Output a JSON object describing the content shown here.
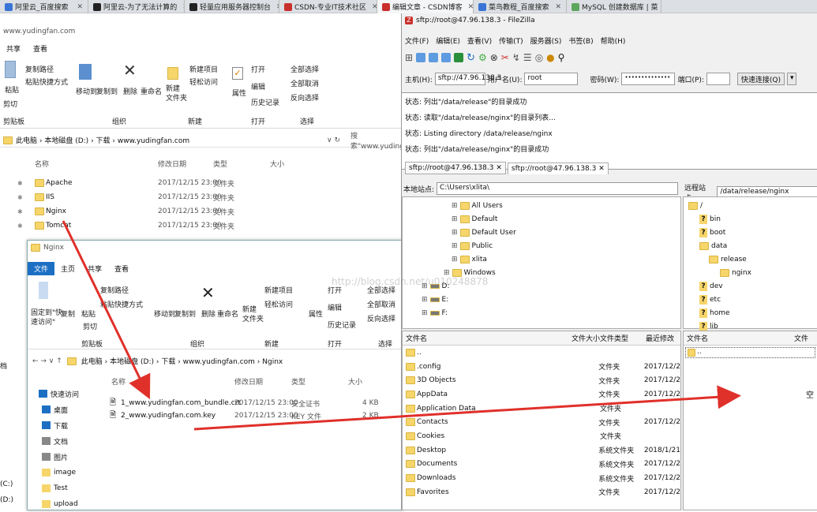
{
  "browser_tabs": [
    {
      "label": "阿里云_百度搜索",
      "color": "#3a74d6"
    },
    {
      "label": "阿里云-为了无法计算的",
      "color": "#222"
    },
    {
      "label": "轻量应用服务器控制台",
      "color": "#222"
    },
    {
      "label": "CSDN-专业IT技术社区",
      "color": "#c9302c"
    },
    {
      "label": "编辑文章 - CSDN博客",
      "color": "#c9302c",
      "active": true
    },
    {
      "label": "菜鸟教程_百度搜索",
      "color": "#3a74d6"
    },
    {
      "label": "MySQL 创建数据库 | 菜",
      "color": "#5ca65c"
    }
  ],
  "explorer": {
    "address_url": "www.yudingfan.com",
    "ribbon_tabs": [
      "共享",
      "查看"
    ],
    "ribbon": {
      "paste": "粘贴",
      "copy_path": "复制路径",
      "paste_shortcut": "粘贴快捷方式",
      "cut": "剪切",
      "move_to": "移动到",
      "copy_to": "复制到",
      "delete": "删除",
      "rename": "重命名",
      "new_item": "新建项目",
      "easy_access": "轻松访问",
      "new_folder": "新建\n文件夹",
      "properties": "属性",
      "open": "打开",
      "edit": "编辑",
      "history": "历史记录",
      "select_all": "全部选择",
      "select_none": "全部取消",
      "invert": "反向选择",
      "groups": [
        "剪贴板",
        "组织",
        "新建",
        "打开",
        "选择"
      ]
    },
    "path": [
      "此电脑",
      "本地磁盘 (D:)",
      "下载",
      "www.yudingfan.com"
    ],
    "search_placeholder": "搜索\"www.yuding",
    "columns": [
      "名称",
      "修改日期",
      "类型",
      "大小"
    ],
    "rows": [
      {
        "name": "Apache",
        "date": "2017/12/15 23:00",
        "type": "文件夹"
      },
      {
        "name": "IIS",
        "date": "2017/12/15 23:00",
        "type": "文件夹"
      },
      {
        "name": "Nginx",
        "date": "2017/12/15 23:00",
        "type": "文件夹"
      },
      {
        "name": "Tomcat",
        "date": "2017/12/15 23:00",
        "type": "文件夹"
      }
    ],
    "left_side_labels": [
      "档",
      "(C:)",
      "(D:)"
    ]
  },
  "explorer2": {
    "title": "Nginx",
    "ribbon_tabs": [
      "文件",
      "主页",
      "共享",
      "查看"
    ],
    "pin": "固定到\"快\n速访问\"",
    "copy": "复制",
    "paste": "粘贴",
    "cut": "剪切",
    "path": [
      "此电脑",
      "本地磁盘 (D:)",
      "下载",
      "www.yudingfan.com",
      "Nginx"
    ],
    "columns": [
      "名称",
      "修改日期",
      "类型",
      "大小"
    ],
    "files": [
      {
        "name": "1_www.yudingfan.com_bundle.crt",
        "date": "2017/12/15 23:00",
        "type": "安全证书",
        "size": "4 KB"
      },
      {
        "name": "2_www.yudingfan.com.key",
        "date": "2017/12/15 23:00",
        "type": "KEY 文件",
        "size": "2 KB"
      }
    ],
    "nav": [
      "快速访问",
      "桌面",
      "下载",
      "文档",
      "图片",
      "image",
      "Test",
      "upload"
    ]
  },
  "filezilla": {
    "title": "sftp://root@47.96.138.3 - FileZilla",
    "menu": [
      "文件(F)",
      "编辑(E)",
      "查看(V)",
      "传输(T)",
      "服务器(S)",
      "书签(B)",
      "帮助(H)"
    ],
    "host_label": "主机(H):",
    "host": "sftp://47.96.138.3",
    "user_label": "用户名(U):",
    "user": "root",
    "pass_label": "密码(W):",
    "pass": "••••••••••••••",
    "port_label": "端口(P):",
    "port": "",
    "connect": "快速连接(Q)",
    "log": [
      "状态:  列出\"/data/release\"的目录成功",
      "状态:  读取\"/data/release/nginx\"的目录列表...",
      "状态:  Listing directory /data/release/nginx",
      "状态:  列出\"/data/release/nginx\"的目录成功"
    ],
    "tabs": [
      "sftp://root@47.96.138.3",
      "sftp://root@47.96.138.3"
    ],
    "local_label": "本地站点:",
    "local_path": "C:\\Users\\xlita\\",
    "remote_label": "远程站点:",
    "remote_path": "/data/release/nginx",
    "local_tree": [
      "All Users",
      "Default",
      "Default User",
      "Public",
      "xlita",
      "Windows",
      "D:",
      "E:",
      "F:"
    ],
    "remote_tree": [
      "/",
      "bin",
      "boot",
      "data",
      "release",
      "nginx",
      "dev",
      "etc",
      "home",
      "lib"
    ],
    "local_cols": [
      "文件名",
      "文件大小",
      "文件类型",
      "最近修改"
    ],
    "remote_cols": [
      "文件名",
      "文件"
    ],
    "local_files": [
      {
        "name": "..",
        "type": "",
        "date": ""
      },
      {
        "name": ".config",
        "type": "文件夹",
        "date": "2017/12/2"
      },
      {
        "name": "3D Objects",
        "type": "文件夹",
        "date": "2017/12/2"
      },
      {
        "name": "AppData",
        "type": "文件夹",
        "date": "2017/12/2"
      },
      {
        "name": "Application Data",
        "type": "文件夹",
        "date": ""
      },
      {
        "name": "Contacts",
        "type": "文件夹",
        "date": "2017/12/2"
      },
      {
        "name": "Cookies",
        "type": "文件夹",
        "date": ""
      },
      {
        "name": "Desktop",
        "type": "系统文件夹",
        "date": "2018/1/21"
      },
      {
        "name": "Documents",
        "type": "系统文件夹",
        "date": "2017/12/2"
      },
      {
        "name": "Downloads",
        "type": "系统文件夹",
        "date": "2017/12/2"
      },
      {
        "name": "Favorites",
        "type": "文件夹",
        "date": "2017/12/2"
      }
    ],
    "remote_files": [
      ".."
    ],
    "remote_empty": "空"
  },
  "watermark": "http://blog.csdn.net/u010248878",
  "colors": {
    "arrow": "#e0302a",
    "fz_red": "#c9302c",
    "folder": "#f6d56a"
  }
}
